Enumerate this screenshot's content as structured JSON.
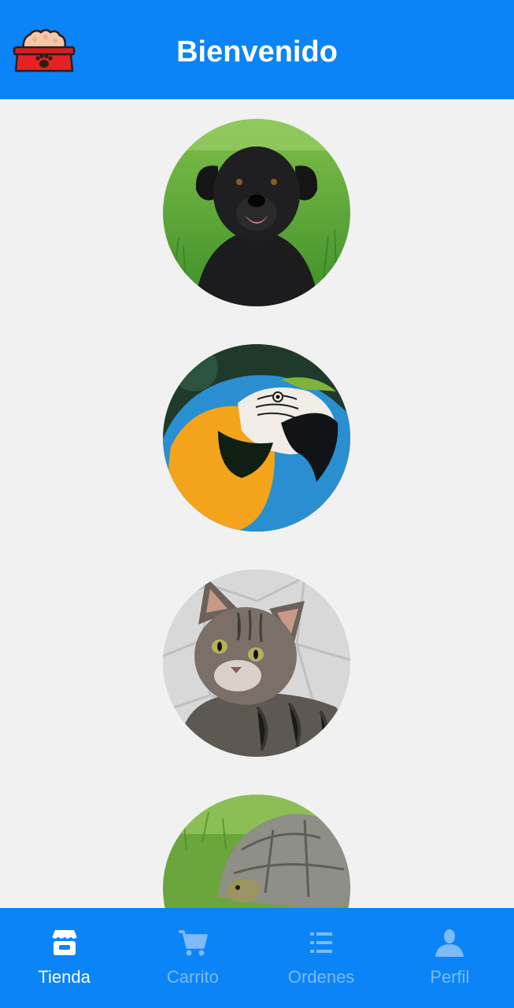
{
  "header": {
    "title": "Bienvenido",
    "logo_icon": "pet-food-bowl-icon",
    "background_color": "#0a84f7"
  },
  "feed": {
    "items": [
      {
        "animal": "dog",
        "icon": "dog-photo"
      },
      {
        "animal": "parrot",
        "icon": "parrot-photo"
      },
      {
        "animal": "cat",
        "icon": "cat-photo"
      },
      {
        "animal": "turtle",
        "icon": "turtle-photo"
      }
    ]
  },
  "bottom_nav": {
    "active_index": 0,
    "active_color": "#ffffff",
    "inactive_color": "#7dbbf9",
    "tabs": [
      {
        "label": "Tienda",
        "icon": "store-icon"
      },
      {
        "label": "Carrito",
        "icon": "cart-icon"
      },
      {
        "label": "Ordenes",
        "icon": "list-icon"
      },
      {
        "label": "Perfil",
        "icon": "person-icon"
      }
    ]
  }
}
